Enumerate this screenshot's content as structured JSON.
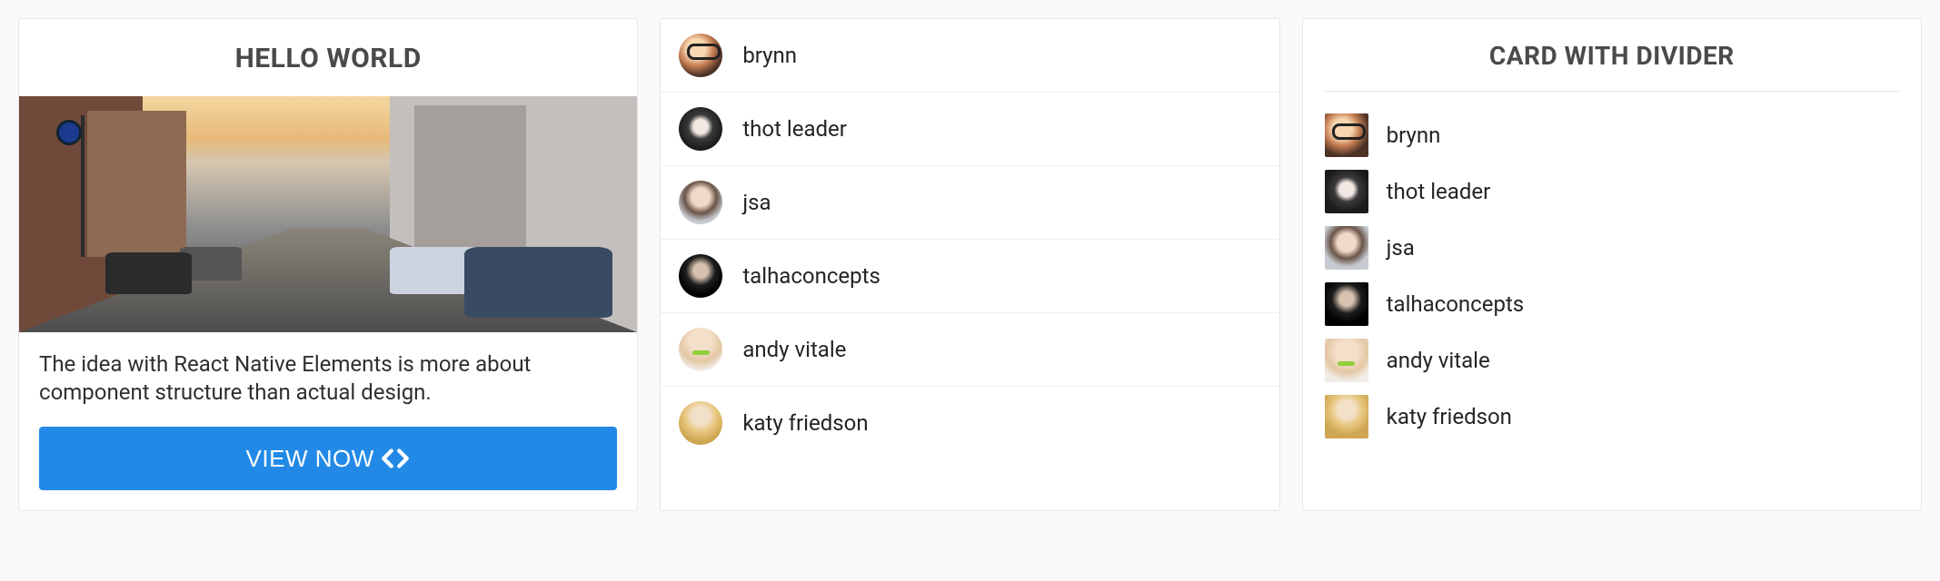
{
  "card1": {
    "title": "HELLO WORLD",
    "description": "The idea with React Native Elements is more about component structure than actual design.",
    "button_label": "VIEW NOW",
    "button_icon": "code-icon"
  },
  "users": [
    {
      "name": "brynn",
      "avatar": "av-brynn"
    },
    {
      "name": "thot leader",
      "avatar": "av-thot"
    },
    {
      "name": "jsa",
      "avatar": "av-jsa"
    },
    {
      "name": "talhaconcepts",
      "avatar": "av-talha"
    },
    {
      "name": "andy vitale",
      "avatar": "av-andy"
    },
    {
      "name": "katy friedson",
      "avatar": "av-katy"
    }
  ],
  "card3": {
    "title": "CARD WITH DIVIDER"
  }
}
